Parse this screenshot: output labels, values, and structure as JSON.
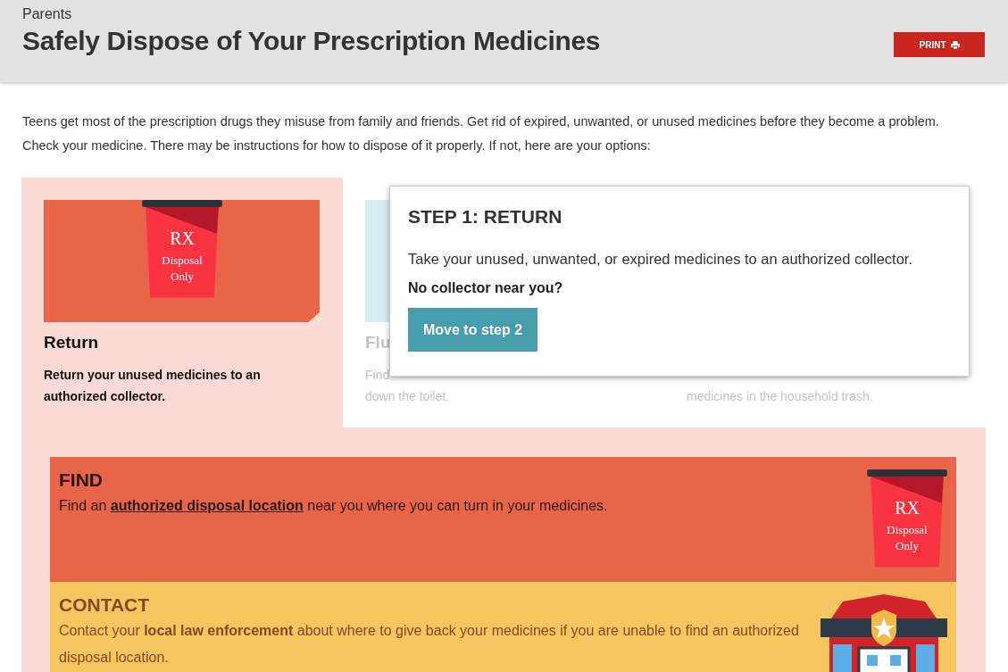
{
  "breadcrumb": "Parents",
  "title": "Safely Dispose of Your Prescription Medicines",
  "print_button": {
    "label": "PRINT"
  },
  "intro": [
    "Teens get most of the prescription drugs they misuse from family and friends. Get rid of expired, unwanted, or unused medicines before they become a problem.",
    "Check your medicine. There may be instructions for how to dispose of it properly. If not, here are your options:"
  ],
  "options": [
    {
      "kind": "return",
      "selected": true,
      "title": "Return",
      "description": [
        "Return your unused medicines to an",
        "authorized collector."
      ],
      "bin_label": [
        "RX",
        "Disposal",
        "Only"
      ]
    },
    {
      "kind": "flush",
      "selected": false,
      "title": "Flu",
      "description": [
        "Find",
        "down the toilet."
      ]
    },
    {
      "kind": "trash",
      "selected": false,
      "description": [
        "medicines in the household trash."
      ]
    }
  ],
  "popup": {
    "title": "STEP 1: RETURN",
    "body": "Take your unused, unwanted, or expired medicines to an authorized collector.",
    "question": "No collector near you?",
    "button": "Move to step 2"
  },
  "steps": [
    {
      "kind": "find",
      "heading": "FIND",
      "text_before": "Find an",
      "link": "authorized disposal location",
      "text_after": "near you where you can turn in your medicines.",
      "bin_label": [
        "RX",
        "Disposal",
        "Only"
      ]
    },
    {
      "kind": "contact",
      "heading": "CONTACT",
      "text": "Contact your **local law enforcement** about where to give back your medicines if you are unable to find an authorized disposal location."
    }
  ]
}
